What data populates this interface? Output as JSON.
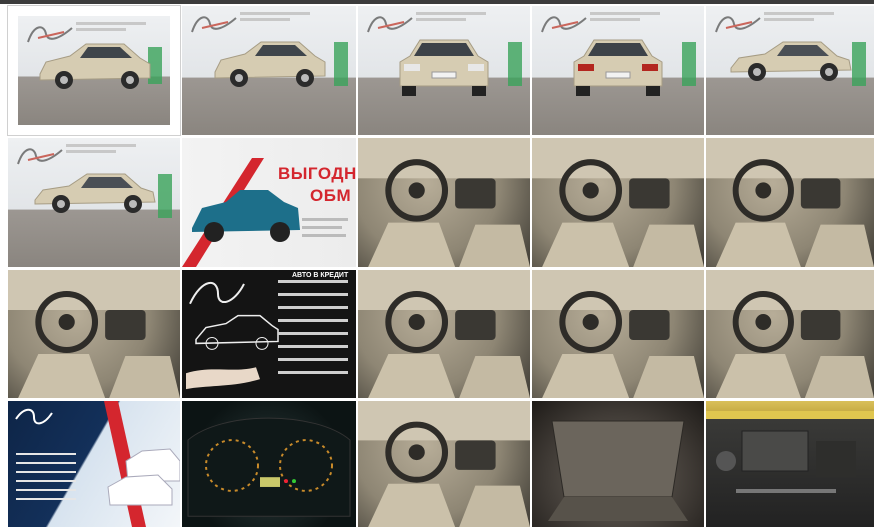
{
  "gallery": {
    "thumbnails": [
      {
        "name": "thumb-front-three-quarter",
        "scene": "showroom",
        "selected": true
      },
      {
        "name": "thumb-rear-three-quarter",
        "scene": "showroom"
      },
      {
        "name": "thumb-front",
        "scene": "showroom"
      },
      {
        "name": "thumb-rear",
        "scene": "showroom"
      },
      {
        "name": "thumb-right-side",
        "scene": "showroom"
      },
      {
        "name": "thumb-left-side",
        "scene": "showroom"
      },
      {
        "name": "thumb-promo-trade-in",
        "scene": "promo-white",
        "promo_lines": [
          "ВЫГОДНЫ",
          "ОБМ"
        ]
      },
      {
        "name": "thumb-driver-interior",
        "scene": "interior"
      },
      {
        "name": "thumb-steering-wheel",
        "scene": "interior"
      },
      {
        "name": "thumb-center-console",
        "scene": "interior"
      },
      {
        "name": "thumb-passenger-seats",
        "scene": "interior"
      },
      {
        "name": "thumb-promo-credit",
        "scene": "dark",
        "promo_lines": [
          "АВТО В КРЕДИТ"
        ]
      },
      {
        "name": "thumb-door-card-front",
        "scene": "interior"
      },
      {
        "name": "thumb-door-card-rear",
        "scene": "interior"
      },
      {
        "name": "thumb-rear-seats",
        "scene": "interior"
      },
      {
        "name": "thumb-promo-dealer",
        "scene": "promo-blue"
      },
      {
        "name": "thumb-instrument-cluster",
        "scene": "dash"
      },
      {
        "name": "thumb-climate-controls",
        "scene": "interior"
      },
      {
        "name": "thumb-trunk",
        "scene": "trunk"
      },
      {
        "name": "thumb-engine-bay",
        "scene": "engine"
      }
    ]
  },
  "colors": {
    "car_body": "#d6ccb2",
    "car_shadow": "#a69c84",
    "promo_red": "#d4262e",
    "selected_border": "#ffffff"
  }
}
